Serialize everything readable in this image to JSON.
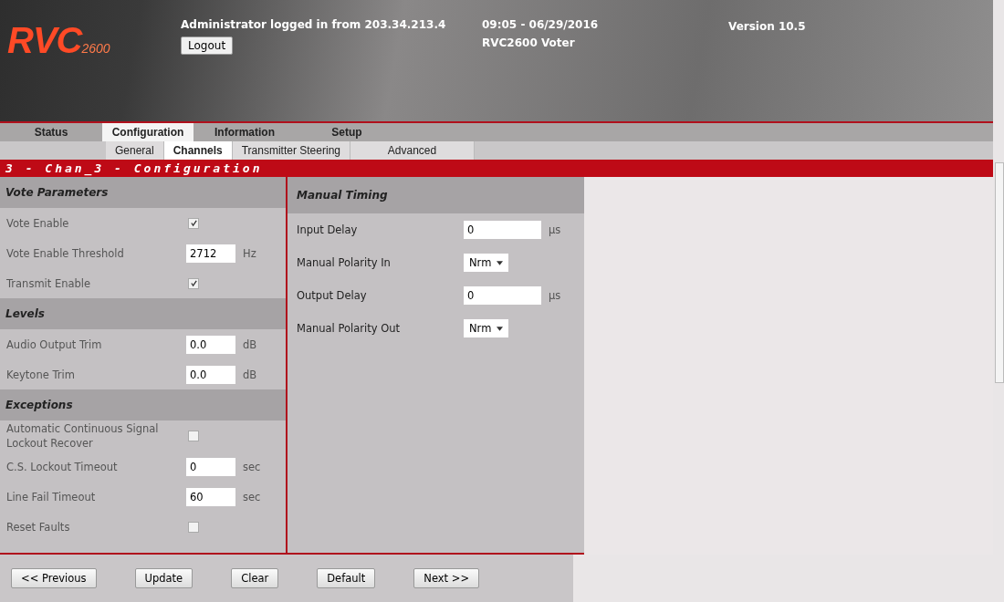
{
  "header": {
    "logo": {
      "main": "RVC",
      "sub": "2600"
    },
    "login": "Administrator logged in from 203.34.213.4",
    "logout": "Logout",
    "datetime": "09:05 - 06/29/2016",
    "device": "RVC2600 Voter",
    "version": "Version 10.5"
  },
  "tabs": [
    {
      "label": "Status",
      "selected": false
    },
    {
      "label": "Configuration",
      "selected": true
    },
    {
      "label": "Information",
      "selected": false
    },
    {
      "label": "Setup",
      "selected": false
    }
  ],
  "subtabs": [
    {
      "label": "General",
      "selected": false
    },
    {
      "label": "Channels",
      "selected": true
    },
    {
      "label": "Transmitter Steering",
      "selected": false
    },
    {
      "label": "Advanced",
      "selected": false
    }
  ],
  "title": "3 - Chan_3 - Configuration",
  "left": [
    {
      "title": "Vote Parameters",
      "rows": [
        {
          "kind": "checkbox",
          "label": "Vote Enable",
          "checked": true
        },
        {
          "kind": "input",
          "label": "Vote Enable Threshold",
          "value": "2712",
          "unit": "Hz"
        },
        {
          "kind": "checkbox",
          "label": "Transmit Enable",
          "checked": true
        }
      ]
    },
    {
      "title": "Levels",
      "rows": [
        {
          "kind": "input",
          "label": "Audio Output Trim",
          "value": "0.0",
          "unit": "dB"
        },
        {
          "kind": "input",
          "label": "Keytone Trim",
          "value": "0.0",
          "unit": "dB"
        }
      ]
    },
    {
      "title": "Exceptions",
      "rows": [
        {
          "kind": "checkbox",
          "label": "Automatic Continuous Signal Lockout Recover",
          "checked": false
        },
        {
          "kind": "input",
          "label": "C.S. Lockout Timeout",
          "value": "0",
          "unit": "sec"
        },
        {
          "kind": "input",
          "label": "Line Fail Timeout",
          "value": "60",
          "unit": "sec"
        },
        {
          "kind": "checkbox",
          "label": "Reset Faults",
          "checked": false
        }
      ]
    }
  ],
  "middle": [
    {
      "title": "Manual Timing",
      "rows": [
        {
          "kind": "input",
          "label": "Input Delay",
          "value": "0",
          "unit": "µs"
        },
        {
          "kind": "select",
          "label": "Manual Polarity In",
          "value": "Nrm"
        },
        {
          "kind": "input",
          "label": "Output Delay",
          "value": "0",
          "unit": "µs"
        },
        {
          "kind": "select",
          "label": "Manual Polarity Out",
          "value": "Nrm"
        }
      ]
    }
  ],
  "buttons": [
    "<< Previous",
    "Update",
    "Clear",
    "Default",
    "Next >>"
  ]
}
